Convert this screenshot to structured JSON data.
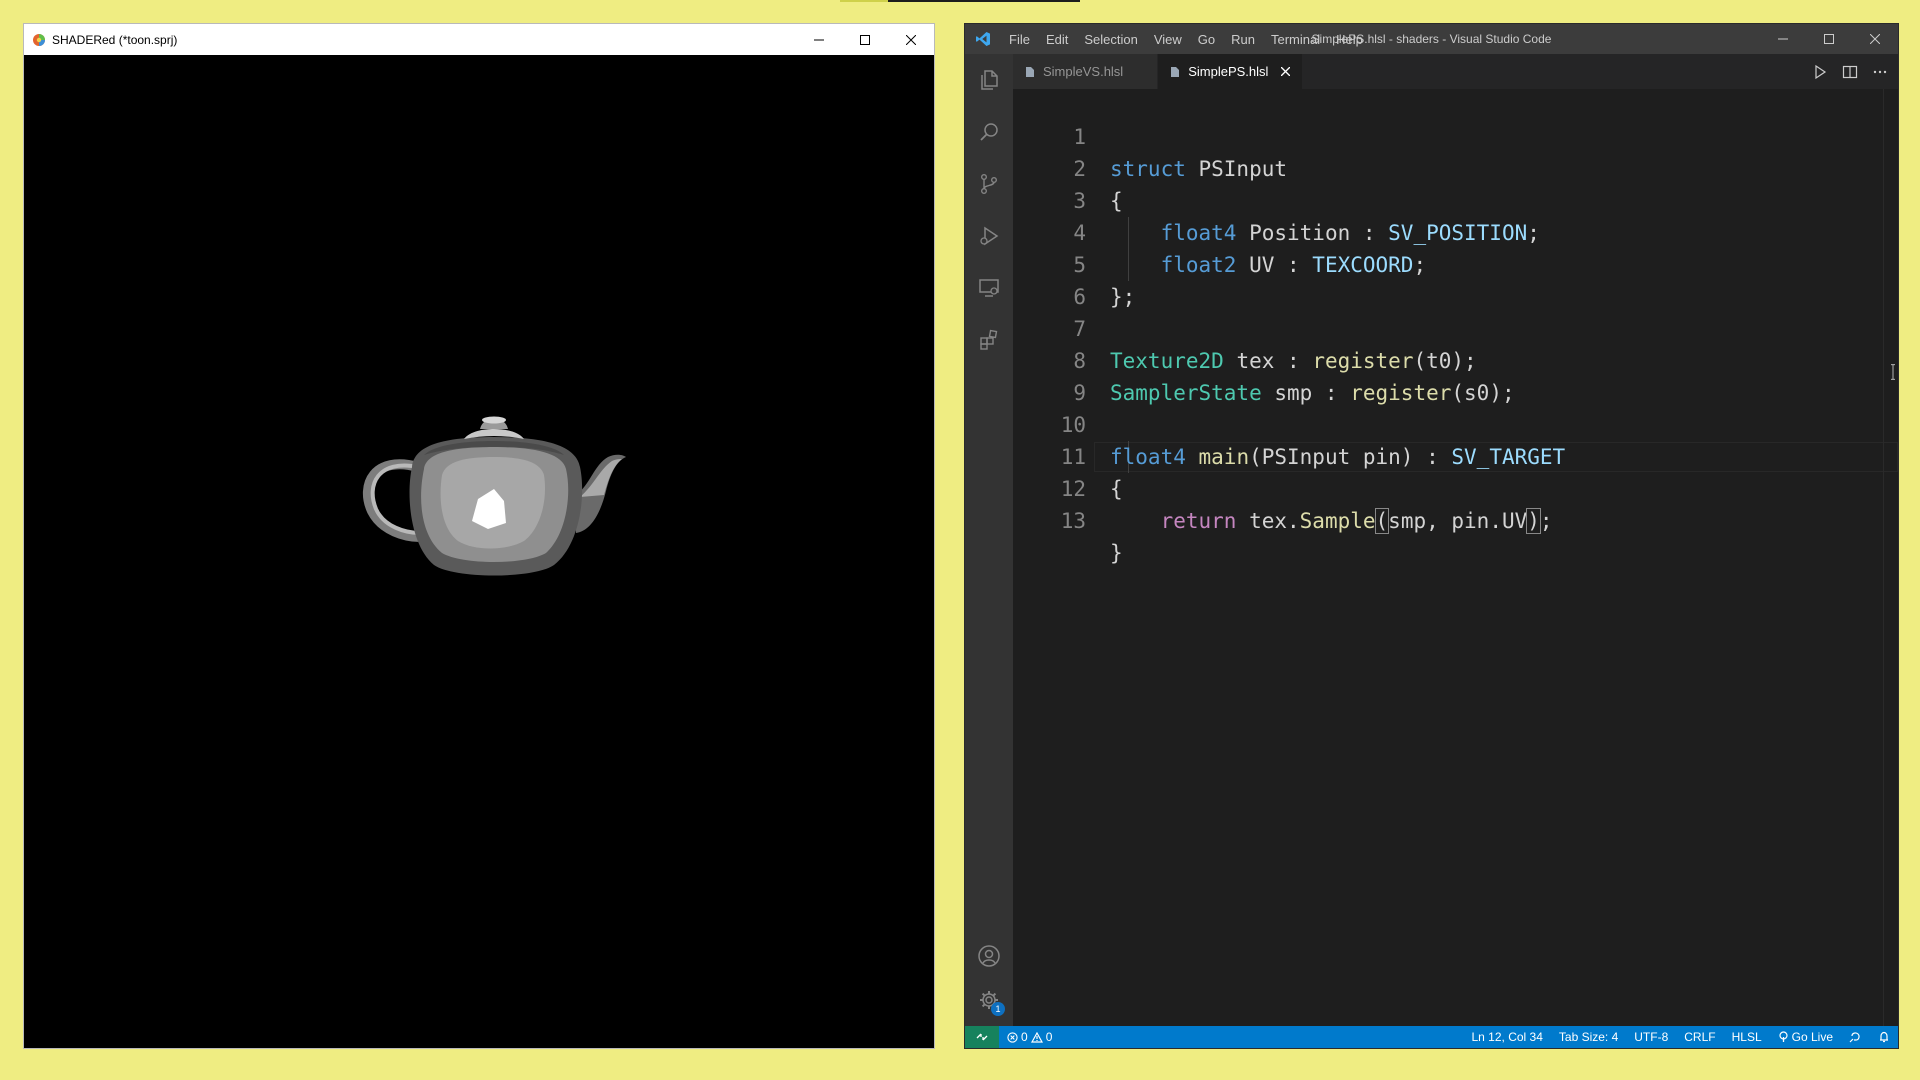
{
  "shadered": {
    "title": "SHADERed (*toon.sprj)",
    "buttons": {
      "minimize": "—",
      "maximize": "☐",
      "close": "✕"
    }
  },
  "vscode": {
    "menu": [
      "File",
      "Edit",
      "Selection",
      "View",
      "Go",
      "Run",
      "Terminal",
      "Help"
    ],
    "window_title": "SimplePS.hlsl - shaders - Visual Studio Code",
    "buttons": {
      "minimize": "—",
      "maximize": "☐",
      "close": "✕"
    },
    "tabs": [
      {
        "label": "SimpleVS.hlsl",
        "active": false
      },
      {
        "label": "SimplePS.hlsl",
        "active": true
      }
    ],
    "settings_badge": "1",
    "code_lines": [
      "1",
      "2",
      "3",
      "4",
      "5",
      "6",
      "7",
      "8",
      "9",
      "10",
      "11",
      "12",
      "13"
    ],
    "code": {
      "l1_kw": "struct",
      "l1_name": " PSInput",
      "l2": "{",
      "l3_type": "float4",
      "l3_name": " Position : ",
      "l3_sem": "SV_POSITION",
      "l3_end": ";",
      "l4_type": "float2",
      "l4_name": " UV : ",
      "l4_sem": "TEXCOORD",
      "l4_end": ";",
      "l5": "};",
      "l7_type": "Texture2D",
      "l7_a": " tex : ",
      "l7_fn": "register",
      "l7_b": "(t0);",
      "l8_type": "SamplerState",
      "l8_a": " smp : ",
      "l8_fn": "register",
      "l8_b": "(s0);",
      "l10_type": "float4",
      "l10_sp": " ",
      "l10_fn": "main",
      "l10_a": "(PSInput pin) : ",
      "l10_sem": "SV_TARGET",
      "l11": "{",
      "l12_ret": "return",
      "l12_a": " tex.",
      "l12_fn": "Sample",
      "l12_p1": "(",
      "l12_b": "smp, pin.UV",
      "l12_p2": ")",
      "l12_end": ";",
      "l13": "}"
    },
    "status": {
      "errors": "0",
      "warnings": "0",
      "position": "Ln 12, Col 34",
      "tab_size": "Tab Size: 4",
      "encoding": "UTF-8",
      "eol": "CRLF",
      "language": "HLSL",
      "golive": "Go Live"
    },
    "colors": {
      "statusbar": "#007acc",
      "remote": "#16825d",
      "keyword": "#569cd6",
      "type": "#4ec9b0",
      "function": "#dcdcaa",
      "control": "#c586c0"
    }
  }
}
